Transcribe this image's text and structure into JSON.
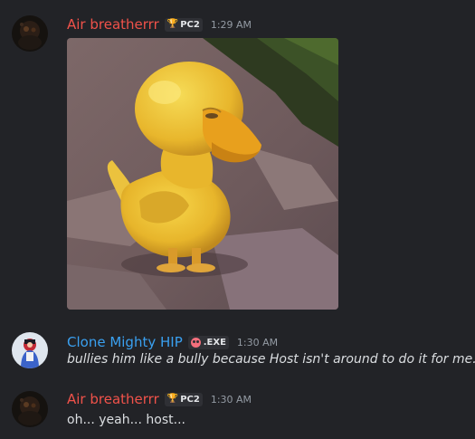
{
  "messages": [
    {
      "username": "Air breatherrr",
      "tag": "PC2",
      "tag_icon": "trophy-icon",
      "timestamp": "1:29 AM",
      "text": "",
      "attachment": "duck-image",
      "name_color": "#f0524a"
    },
    {
      "username": "Clone Mighty HIP",
      "tag": ".EXE",
      "tag_icon": "skull-icon",
      "timestamp": "1:30 AM",
      "text": "bullies him like a bully because Host isn't around to do it for me.",
      "italic": true,
      "name_color": "#3aa0f0"
    },
    {
      "username": "Air breatherrr",
      "tag": "PC2",
      "tag_icon": "trophy-icon",
      "timestamp": "1:30 AM",
      "text": "oh... yeah... host...",
      "name_color": "#f0524a"
    }
  ],
  "colors": {
    "background": "#222327",
    "text": "#dbdee1",
    "timestamp": "#949ba4",
    "tag_bg": "#2f3035"
  }
}
